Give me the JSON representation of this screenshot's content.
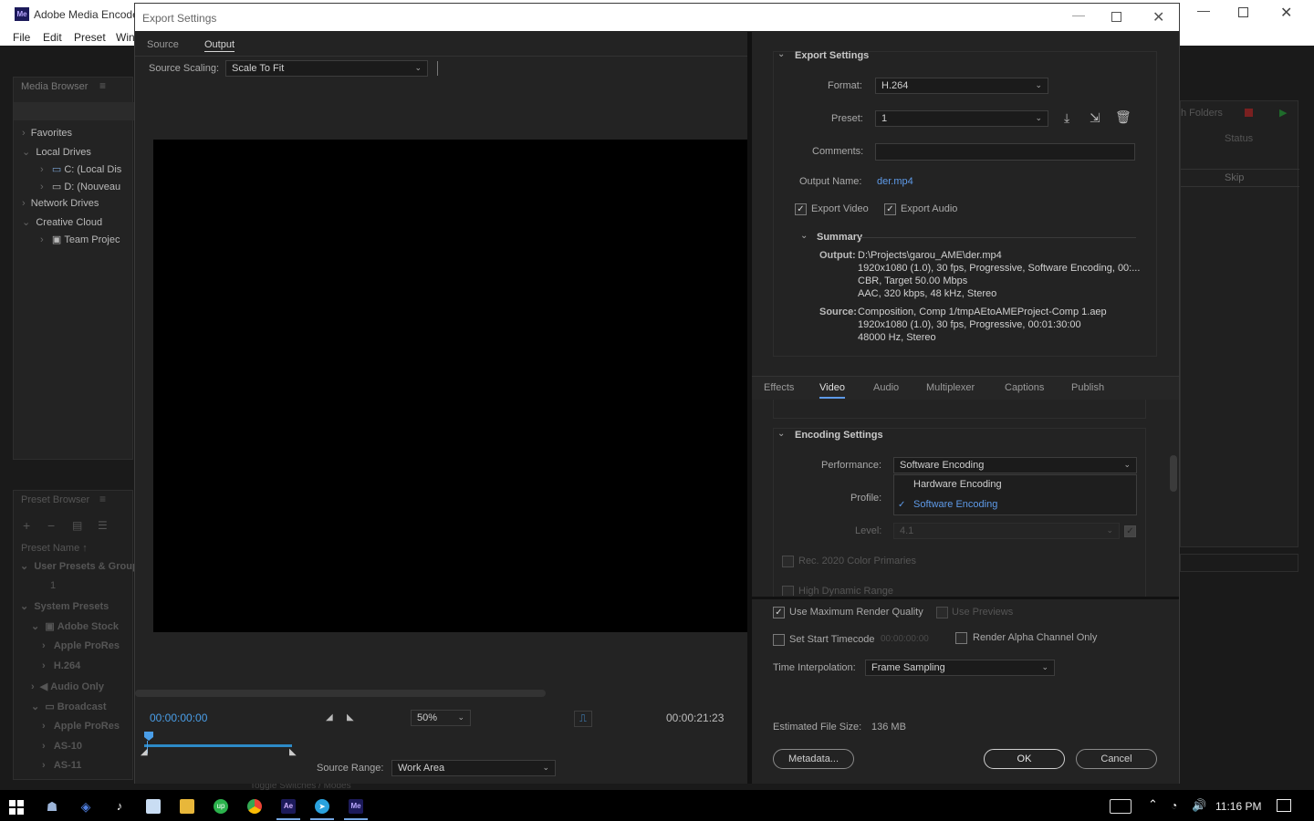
{
  "app": {
    "title": "Adobe Media Encoder",
    "menu": [
      "File",
      "Edit",
      "Preset",
      "Win"
    ],
    "media_browser": {
      "header": "Media Browser",
      "items": [
        "Favorites",
        "Local Drives",
        "C: (Local Dis",
        "D: (Nouveau",
        "Network Drives",
        "Creative Cloud",
        "Team Projec"
      ]
    },
    "preset_browser": {
      "header": "Preset Browser",
      "column": "Preset Name",
      "items": [
        "User Presets & Group",
        "1",
        "System Presets",
        "Adobe Stock",
        "Apple ProRes",
        "H.264",
        "Audio Only",
        "Broadcast",
        "Apple ProRes",
        "AS-10",
        "AS-11"
      ]
    },
    "queue": {
      "folders_label": "h Folders",
      "status_header": "Status",
      "skip_label": "Skip"
    },
    "bottom_status": "Toggle Switches / Modes"
  },
  "dialog": {
    "title": "Export Settings",
    "tabs": [
      "Source",
      "Output"
    ],
    "active_tab": "Output",
    "source_scaling_label": "Source Scaling:",
    "source_scaling_value": "Scale To Fit",
    "timecode_current": "00:00:00:00",
    "timecode_end": "00:00:21:23",
    "zoom": "50%",
    "source_range_label": "Source Range:",
    "source_range_value": "Work Area",
    "export_settings": {
      "header": "Export Settings",
      "format_label": "Format:",
      "format_value": "H.264",
      "preset_label": "Preset:",
      "preset_value": "1",
      "comments_label": "Comments:",
      "output_name_label": "Output Name:",
      "output_name_value": "der.mp4",
      "export_video_label": "Export Video",
      "export_audio_label": "Export Audio",
      "summary_header": "Summary",
      "output_label": "Output:",
      "output_lines": [
        "D:\\Projects\\garou_AME\\der.mp4",
        "1920x1080 (1.0), 30 fps, Progressive, Software Encoding, 00:...",
        "CBR, Target 50.00 Mbps",
        "AAC, 320 kbps, 48 kHz, Stereo"
      ],
      "source_label": "Source:",
      "source_lines": [
        "Composition, Comp 1/tmpAEtoAMEProject-Comp 1.aep",
        "1920x1080 (1.0), 30 fps, Progressive, 00:01:30:00",
        "48000 Hz, Stereo"
      ]
    },
    "settings_tabs": [
      "Effects",
      "Video",
      "Audio",
      "Multiplexer",
      "Captions",
      "Publish"
    ],
    "active_settings_tab": "Video",
    "encoding": {
      "header": "Encoding Settings",
      "performance_label": "Performance:",
      "performance_value": "Software Encoding",
      "options": [
        "Hardware Encoding",
        "Software Encoding"
      ],
      "selected_option": "Software Encoding",
      "profile_label": "Profile:",
      "level_label": "Level:",
      "level_value": "4.1",
      "rec2020_label": "Rec. 2020 Color Primaries",
      "hdr_label": "High Dynamic Range"
    },
    "bottom": {
      "max_render_label": "Use Maximum Render Quality",
      "use_previews_label": "Use Previews",
      "start_timecode_label": "Set Start Timecode",
      "start_timecode_value": "00:00:00:00",
      "alpha_label": "Render Alpha Channel Only",
      "time_interp_label": "Time Interpolation:",
      "time_interp_value": "Frame Sampling",
      "est_size_label": "Estimated File Size:",
      "est_size_value": "136 MB",
      "metadata_label": "Metadata...",
      "ok_label": "OK",
      "cancel_label": "Cancel"
    }
  },
  "taskbar": {
    "time": "11:16 PM"
  },
  "colors": {
    "accent": "#5e9ae8",
    "dialog_bg": "#232323",
    "timeline": "#2d8ac7"
  }
}
